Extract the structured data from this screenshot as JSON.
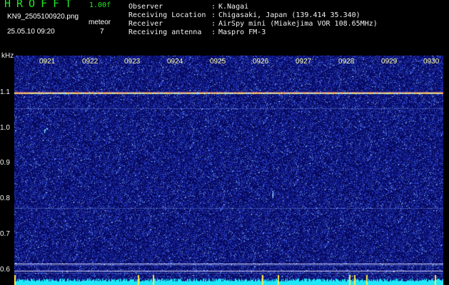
{
  "app": {
    "title": "HROFFT",
    "version": "1.00f",
    "filename": "KN9_2505100920.png",
    "datetime": "25.05.10 09:20",
    "meteor_label": "meteor",
    "meteor_count": "7"
  },
  "metadata": [
    {
      "label": "Observer",
      "value": "K.Nagai"
    },
    {
      "label": "Receiving Location",
      "value": "Chigasaki, Japan (139.414 35.340)"
    },
    {
      "label": "Receiver",
      "value": "AirSpy mini (Miakejima VOR 108.65MHz)"
    },
    {
      "label": "Receiving antenna",
      "value": "Maspro FM-3"
    }
  ],
  "spectrogram": {
    "y_unit": "kHz",
    "y_ticks": [
      "1.1",
      "1.0",
      "0.9",
      "0.8",
      "0.7",
      "0.6"
    ],
    "x_ticks": [
      "0921",
      "0922",
      "0923",
      "0924",
      "0925",
      "0926",
      "0927",
      "0928",
      "0929",
      "0930"
    ],
    "colors": {
      "background": "#05085a",
      "noise": "#2838c8",
      "carrier": "#ff8a3a",
      "tick_text": "#ffffa8",
      "title": "#22e822"
    }
  }
}
